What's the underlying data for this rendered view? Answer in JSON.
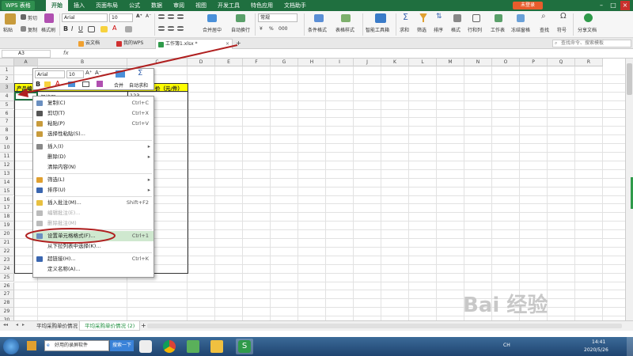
{
  "app": {
    "logo": "WPS 表格",
    "login": "未登录"
  },
  "menu": [
    "开始",
    "插入",
    "页面布局",
    "公式",
    "数据",
    "审阅",
    "视图",
    "开发工具",
    "特色应用",
    "文档助手"
  ],
  "ribbon": {
    "paste": "粘贴",
    "cut": "剪切",
    "copy": "复制",
    "format_painter": "格式刷",
    "font_name": "Arial",
    "font_size": "10",
    "merge_center": "合并居中",
    "wrap_text": "自动换行",
    "number_format": "常规",
    "conditional_format": "条件格式",
    "table_style": "表格样式",
    "smart_toolbox": "智能工具箱",
    "sum": "求和",
    "filter": "筛选",
    "sort": "排序",
    "format": "格式",
    "row_col": "行和列",
    "worksheet": "工作表",
    "freeze": "冻结窗格",
    "find": "查找",
    "symbol": "符号",
    "share": "分享文档",
    "currency": "¥",
    "percent": "%",
    "thousands": "000"
  },
  "tabs": [
    {
      "label": "云文档"
    },
    {
      "label": "我的WPS"
    },
    {
      "label": "工作簿1.xlsx *"
    }
  ],
  "new_tab": "+",
  "search": {
    "placeholder": "查找命令、搜索模板"
  },
  "formula_bar": {
    "cell_ref": "A3",
    "fx": "fx",
    "value": ""
  },
  "grid": {
    "columns": [
      "A",
      "B",
      "C",
      "D",
      "E",
      "F",
      "G",
      "H",
      "I",
      "J",
      "K",
      "L",
      "M",
      "N",
      "O",
      "P",
      "Q",
      "R"
    ],
    "rows": [
      "1",
      "2",
      "3",
      "4",
      "5",
      "6",
      "7",
      "8",
      "9",
      "10",
      "11",
      "12",
      "13",
      "14",
      "15",
      "16",
      "17",
      "18",
      "19",
      "20",
      "21",
      "22",
      "23",
      "24",
      "25",
      "26",
      "27",
      "28",
      "29",
      "30"
    ],
    "a2": "产品编",
    "c2": "价（元/件）",
    "b3": "保护器",
    "c3": "123"
  },
  "mini_toolbar": {
    "font": "Arial",
    "size": "10",
    "merge": "合并",
    "autosum": "自动求和"
  },
  "context_menu": [
    {
      "label": "复制(C)",
      "shortcut": "Ctrl+C",
      "icon": "copy-icon"
    },
    {
      "label": "剪切(T)",
      "shortcut": "Ctrl+X",
      "icon": "scissors-icon"
    },
    {
      "label": "粘贴(P)",
      "shortcut": "Ctrl+V",
      "icon": "clipboard-icon"
    },
    {
      "label": "选择性粘贴(S)...",
      "shortcut": "",
      "icon": "clipboard-special-icon"
    },
    {
      "label": "插入(I)",
      "shortcut": "",
      "icon": "insert-icon"
    },
    {
      "label": "删除(D)",
      "shortcut": "",
      "icon": ""
    },
    {
      "label": "清除内容(N)",
      "shortcut": "",
      "icon": ""
    },
    {
      "label": "筛选(L)",
      "shortcut": "",
      "icon": "filter-icon"
    },
    {
      "label": "排序(U)",
      "shortcut": "",
      "icon": "sort-icon"
    },
    {
      "label": "插入批注(M)...",
      "shortcut": "Shift+F2",
      "icon": "comment-icon"
    },
    {
      "label": "编辑批注(E)...",
      "shortcut": "",
      "icon": "edit-comment-icon"
    },
    {
      "label": "删除批注(M)",
      "shortcut": "",
      "icon": "delete-comment-icon"
    },
    {
      "label": "设置单元格格式(F)...",
      "shortcut": "Ctrl+1",
      "icon": "format-cells-icon"
    },
    {
      "label": "从下拉列表中选择(K)...",
      "shortcut": "",
      "icon": ""
    },
    {
      "label": "超链接(H)...",
      "shortcut": "Ctrl+K",
      "icon": "hyperlink-icon"
    },
    {
      "label": "定义名称(A)...",
      "shortcut": "",
      "icon": ""
    }
  ],
  "sheets": [
    {
      "label": "平均采购单价情况"
    },
    {
      "label": "平均采购单价情况 (2)"
    }
  ],
  "add_sheet": "+",
  "taskbar": {
    "browser_tab": "好用的录屏软件",
    "search_button": "搜索一下",
    "lang": "CH",
    "time": "14:41",
    "date": "2020/5/26"
  },
  "watermark": "Bai 经验",
  "colors": {
    "accent": "#1f6f3f",
    "header_fill": "#ffff00",
    "menu_highlight": "#cfe8cf",
    "annotation": "#b02020"
  }
}
